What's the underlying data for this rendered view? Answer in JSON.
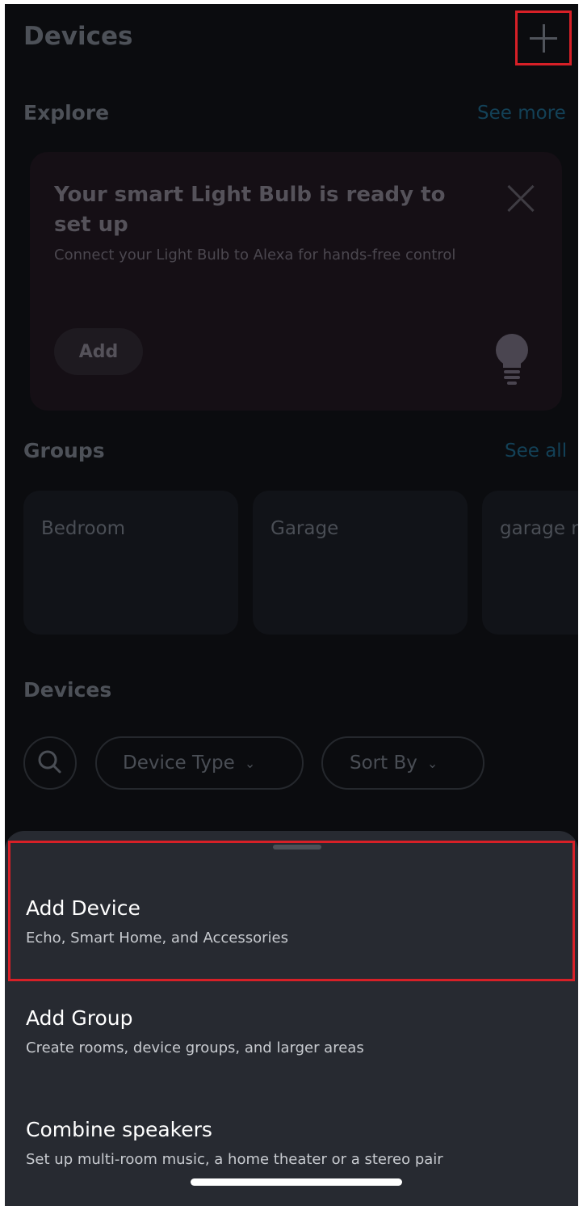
{
  "header": {
    "title": "Devices"
  },
  "explore": {
    "heading": "Explore",
    "see_more": "See more",
    "card": {
      "title": "Your smart Light Bulb is ready to set up",
      "description": "Connect your Light Bulb to Alexa for hands-free control",
      "add_label": "Add"
    }
  },
  "groups": {
    "heading": "Groups",
    "see_all": "See all",
    "items": [
      "Bedroom",
      "Garage",
      "garage ro"
    ]
  },
  "devices": {
    "heading": "Devices",
    "filters": {
      "device_type": "Device Type",
      "sort_by": "Sort By"
    }
  },
  "sheet": {
    "items": [
      {
        "title": "Add Device",
        "subtitle": "Echo, Smart Home, and Accessories"
      },
      {
        "title": "Add Group",
        "subtitle": "Create rooms, device groups, and larger areas"
      },
      {
        "title": "Combine speakers",
        "subtitle": "Set up multi-room music, a home theater or a stereo pair"
      }
    ]
  },
  "colors": {
    "highlight": "#d72027",
    "sheet_bg": "#272a31",
    "link": "#134157"
  }
}
